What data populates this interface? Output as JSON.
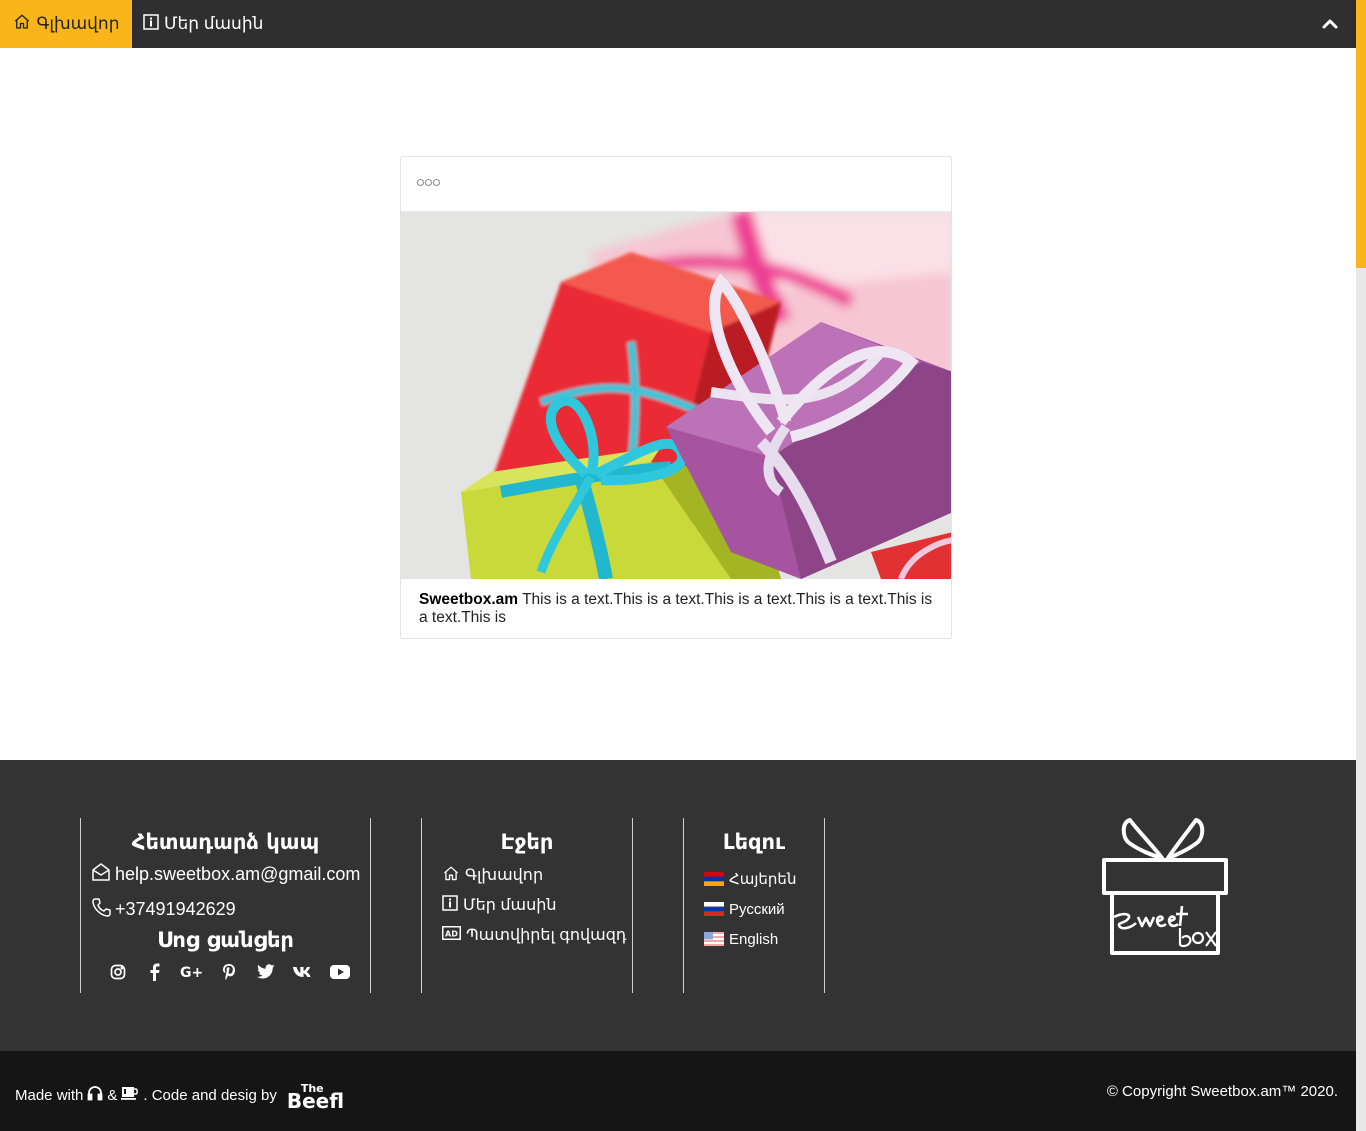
{
  "nav": {
    "home_label": "Գլխավոր",
    "about_label": "Մեր մասին",
    "accent_color": "#f9b51a"
  },
  "card": {
    "caption_brand": "Sweetbox.am",
    "caption_text": " This is a text.This is a text.This is a text.This is a text.This is a text.This is"
  },
  "footer": {
    "contact": {
      "title": "Հետադարձ կապ",
      "email": "help.sweetbox.am@gmail.com",
      "phone": "+37491942629",
      "social_title": "Սոց ցանցեր",
      "social_icons": [
        "instagram-icon",
        "facebook-icon",
        "google-plus-icon",
        "pinterest-icon",
        "twitter-icon",
        "vk-icon",
        "youtube-icon"
      ]
    },
    "pages": {
      "title": "Էջեր",
      "items": [
        {
          "label": "Գլխավոր",
          "icon": "home-icon"
        },
        {
          "label": "Մեր մասին",
          "icon": "info-icon"
        },
        {
          "label": "Պատվիրել գովազդ",
          "icon": "ad-icon"
        }
      ]
    },
    "languages": {
      "title": "Լեզու",
      "items": [
        {
          "label": "Հայերեն",
          "icon": "armenia-flag-icon"
        },
        {
          "label": "Русский",
          "icon": "russia-flag-icon"
        },
        {
          "label": "English",
          "icon": "usa-flag-icon"
        }
      ]
    }
  },
  "bottom": {
    "made_with": "Made with",
    "amp": "&",
    "code_text": ". Code and desig by",
    "brand_the": "The",
    "brand_name": "Beefl",
    "copyright": "© Copyright Sweetbox.am™ 2020."
  }
}
